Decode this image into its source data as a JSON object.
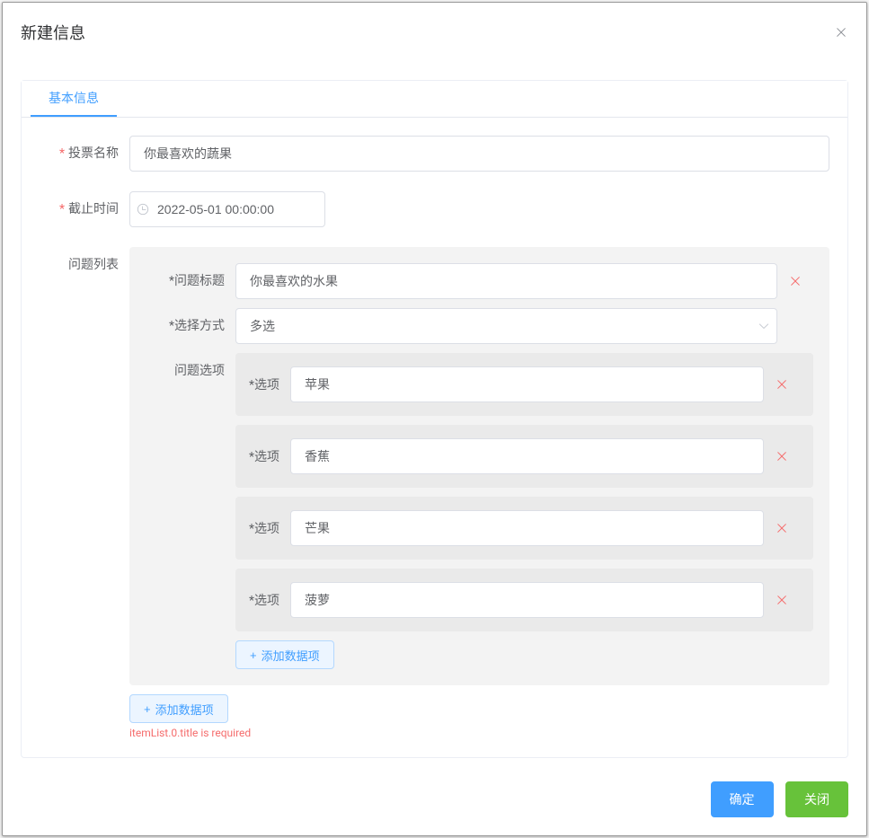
{
  "dialog": {
    "title": "新建信息"
  },
  "tabs": {
    "basic": "基本信息"
  },
  "labels": {
    "voteName": "投票名称",
    "deadline": "截止时间",
    "questionList": "问题列表",
    "questionTitle": "问题标题",
    "selectMode": "选择方式",
    "questionOptions": "问题选项",
    "option": "选项"
  },
  "form": {
    "voteName": "你最喜欢的蔬果",
    "deadline": "2022-05-01 00:00:00",
    "question0": {
      "title": "你最喜欢的水果",
      "mode": "多选",
      "options": [
        "苹果",
        "香蕉",
        "芒果",
        "菠萝"
      ]
    }
  },
  "buttons": {
    "addItem": "添加数据项",
    "confirm": "确定",
    "close": "关闭"
  },
  "error": "itemList.0.title is required"
}
